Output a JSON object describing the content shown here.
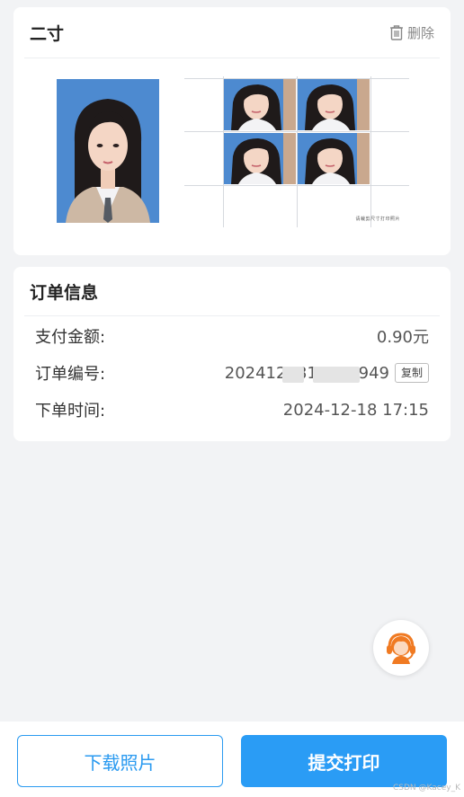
{
  "photo_card": {
    "title": "二寸",
    "delete_label": "删除",
    "sheet_note": "请裁剪尺寸打印照片"
  },
  "order": {
    "title": "订单信息",
    "amount_label": "支付金额:",
    "amount_value": "0.90元",
    "number_label": "订单编号:",
    "number_value": "2024121817150949",
    "copy_label": "复制",
    "time_label": "下单时间:",
    "time_value": "2024-12-18 17:15"
  },
  "actions": {
    "download_label": "下载照片",
    "submit_label": "提交打印"
  },
  "watermark": "CSDN @Kacey_K",
  "colors": {
    "accent": "#2a9cf5",
    "photo_background": "#4d8ad0",
    "page_background": "#f2f3f5"
  },
  "icons": {
    "delete": "trash-icon",
    "support": "customer-service-icon"
  }
}
